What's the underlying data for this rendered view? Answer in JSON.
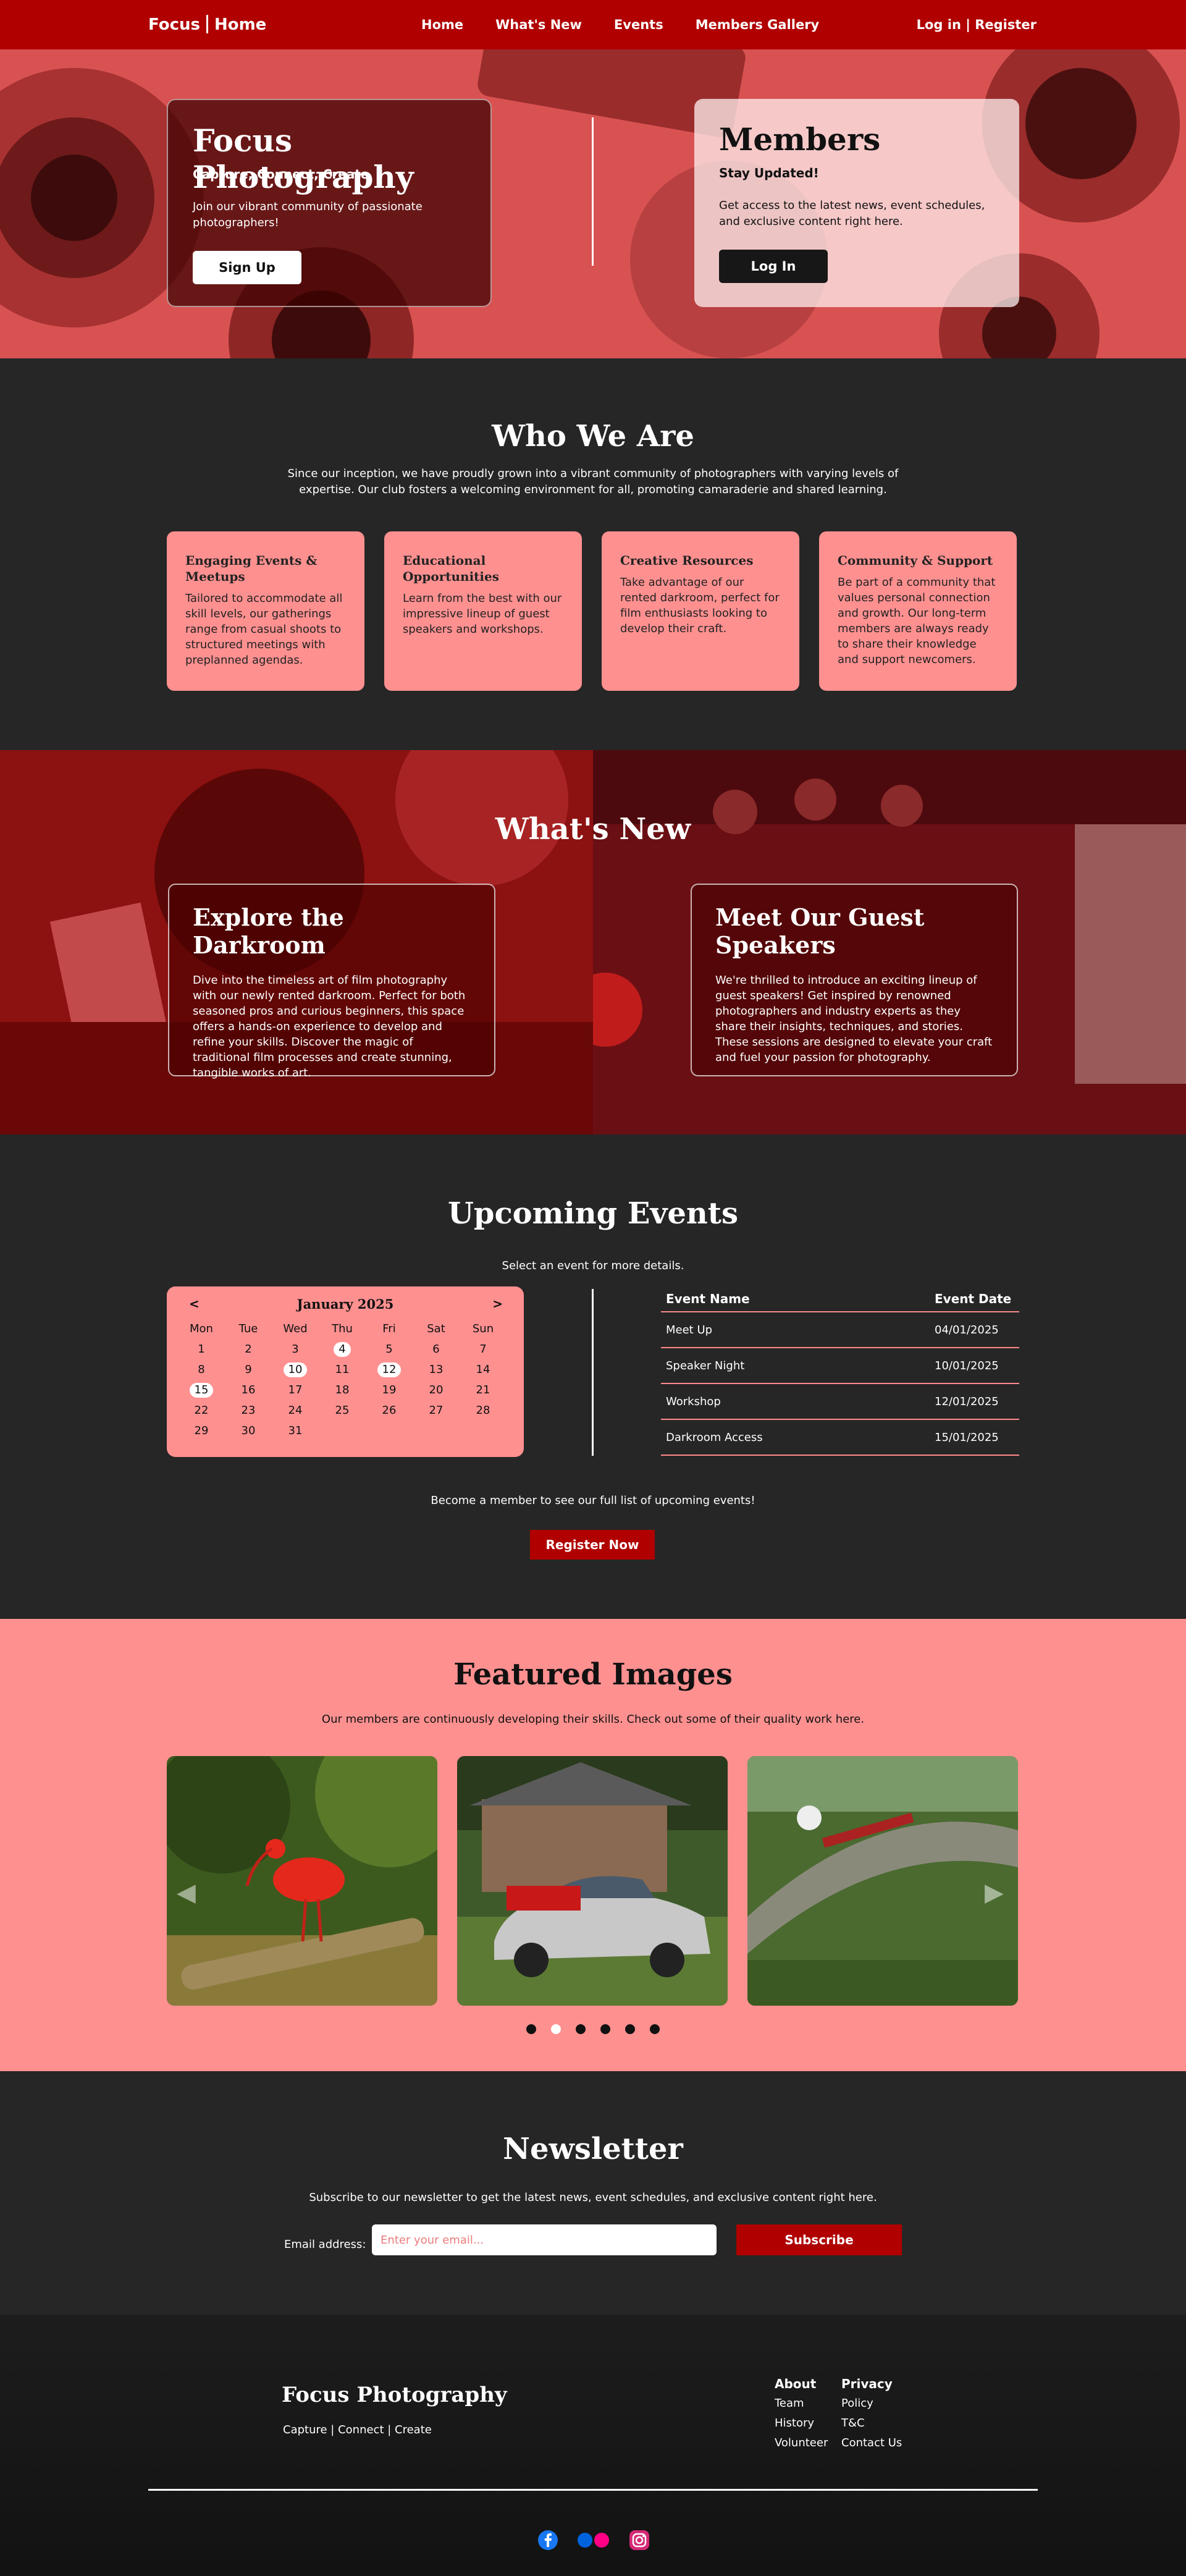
{
  "nav": {
    "brand_left": "Focus",
    "brand_right": "Home",
    "links": [
      "Home",
      "What's New",
      "Events",
      "Members Gallery"
    ],
    "login": "Log in",
    "divider": "|",
    "register": "Register"
  },
  "hero": {
    "left": {
      "title": "Focus Photography",
      "subtitle": "Capture, Connect, Create",
      "text": "Join our vibrant community of passionate photographers!",
      "button": "Sign Up"
    },
    "right": {
      "title": "Members",
      "subtitle": "Stay Updated!",
      "text": "Get access to the latest news, event schedules, and exclusive content right here.",
      "button": "Log In"
    }
  },
  "who": {
    "title": "Who We Are",
    "lead": "Since our inception, we have proudly grown into a vibrant community of photographers with varying levels of expertise. Our club fosters a welcoming environment for all, promoting camaraderie and shared learning.",
    "cards": [
      {
        "title": "Engaging Events & Meetups",
        "text": "Tailored to accommodate all skill levels, our gatherings range from casual shoots to structured meetings with preplanned agendas."
      },
      {
        "title": "Educational Opportunities",
        "text": "Learn from the best with our impressive lineup of guest speakers and workshops."
      },
      {
        "title": "Creative Resources",
        "text": "Take advantage of our rented darkroom, perfect for film enthusiasts looking to develop their craft."
      },
      {
        "title": "Community & Support",
        "text": "Be part of a community that values personal connection and growth. Our long-term members are always ready to share their knowledge and support newcomers."
      }
    ]
  },
  "whats_new": {
    "title": "What's New",
    "left": {
      "title": "Explore the Darkroom",
      "text": "Dive into the timeless art of film photography with our newly rented darkroom. Perfect for both seasoned pros and curious beginners, this space offers a hands-on experience to develop and refine your skills. Discover the magic of traditional film processes and create stunning, tangible works of art."
    },
    "right": {
      "title": "Meet Our Guest Speakers",
      "text": "We're thrilled to introduce an exciting lineup of guest speakers! Get inspired by renowned photographers and industry experts as they share their insights, techniques, and stories. These sessions are designed to elevate your craft and fuel your passion for photography."
    }
  },
  "events": {
    "title": "Upcoming Events",
    "lead": "Select an event for more details.",
    "calendar": {
      "prev": "<",
      "next": ">",
      "month": "January 2025",
      "weekdays": [
        "Mon",
        "Tue",
        "Wed",
        "Thu",
        "Fri",
        "Sat",
        "Sun"
      ],
      "days": [
        "",
        "",
        "",
        "",
        "",
        "",
        "",
        "1",
        "2",
        "3",
        "4",
        "5",
        "6",
        "7",
        "8",
        "9",
        "10",
        "11",
        "12",
        "13",
        "14",
        "15",
        "16",
        "17",
        "18",
        "19",
        "20",
        "21",
        "22",
        "23",
        "24",
        "25",
        "26",
        "27",
        "28",
        "29",
        "30",
        "31",
        "",
        "",
        "",
        ""
      ],
      "highlighted": [
        "4",
        "10",
        "12",
        "15"
      ]
    },
    "table": {
      "headers": [
        "Event Name",
        "Event Date"
      ],
      "rows": [
        [
          "Meet Up",
          "04/01/2025"
        ],
        [
          "Speaker Night",
          "10/01/2025"
        ],
        [
          "Workshop",
          "12/01/2025"
        ],
        [
          "Darkroom Access",
          "15/01/2025"
        ]
      ]
    },
    "note": "Become a member to see our full list of upcoming events!",
    "button": "Register Now"
  },
  "featured": {
    "title": "Featured Images",
    "lead": "Our members are continuously developing their skills. Check out some of their quality work here.",
    "slide_count": 6,
    "active_slide": 1
  },
  "newsletter": {
    "title": "Newsletter",
    "lead": "Subscribe to our newsletter to get the latest news, event schedules, and exclusive content right here.",
    "label": "Email address:",
    "placeholder": "Enter your email...",
    "button": "Subscribe"
  },
  "footer": {
    "brand": "Focus Photography",
    "tagline": "Capture | Connect | Create",
    "about": {
      "heading": "About",
      "links": [
        "Team",
        "History",
        "Volunteer"
      ]
    },
    "privacy": {
      "heading": "Privacy",
      "links": [
        "Policy",
        "T&C",
        "Contact Us"
      ]
    },
    "social": [
      "facebook-icon",
      "flickr-icon",
      "instagram-icon"
    ]
  },
  "colors": {
    "brand_red": "#b00000",
    "salmon": "#ff9090",
    "dark": "#262626"
  }
}
